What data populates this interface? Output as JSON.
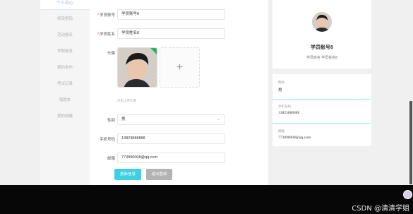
{
  "sidebar": {
    "active_label": "个人中心",
    "items": [
      {
        "label": "修改密码"
      },
      {
        "label": "活动报名"
      },
      {
        "label": "学期信息"
      },
      {
        "label": "我的发布"
      },
      {
        "label": "考试记录"
      },
      {
        "label": "错题本"
      },
      {
        "label": "我的收藏"
      }
    ]
  },
  "form": {
    "account_label": "学员账号",
    "account_value": "学员账号8",
    "name_label": "学员姓名",
    "name_value": "学员姓名8",
    "avatar_label": "头像",
    "upload_tip": "点击上传头像",
    "gender_label": "性别",
    "gender_value": "男",
    "phone_label": "手机号码",
    "phone_value": "13823888888",
    "email_label": "邮箱",
    "email_value": "773890008@qq.com",
    "update_button": "更新信息",
    "logout_button": "退出登录"
  },
  "profile": {
    "name": "学员账号8",
    "subtitle": "学员姓名 学员姓名8",
    "gender_label": "性别",
    "gender_value": "男",
    "phone_label": "手机号码",
    "phone_value": "13823888888",
    "email_label": "邮箱",
    "email_value": "773890008@qq.com"
  },
  "watermark": "CSDN @清清学姐",
  "colors": {
    "primary_button": "#3ed0e1",
    "secondary_button": "#b3b3b3",
    "separator": "#9fe3ec"
  }
}
